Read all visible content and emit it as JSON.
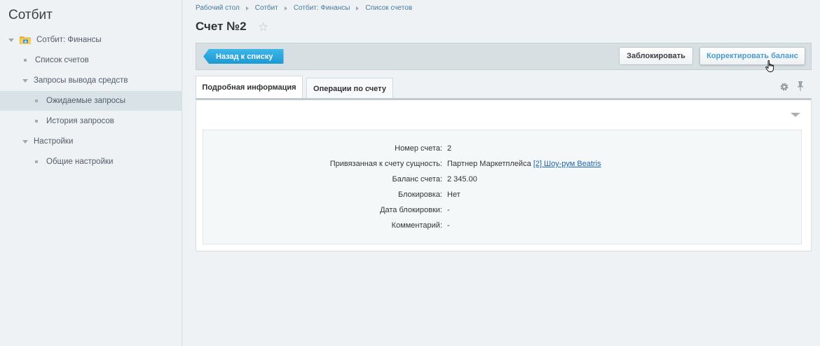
{
  "sidebar": {
    "title": "Сотбит",
    "items": [
      {
        "label": "Сотбит: Финансы"
      },
      {
        "label": "Список счетов"
      },
      {
        "label": "Запросы вывода средств"
      },
      {
        "label": "Ожидаемые запросы"
      },
      {
        "label": "История запросов"
      },
      {
        "label": "Настройки"
      },
      {
        "label": "Общие настройки"
      }
    ]
  },
  "breadcrumb": [
    "Рабочий стол",
    "Сотбит",
    "Сотбит: Финансы",
    "Список счетов"
  ],
  "page": {
    "title": "Счет №2"
  },
  "toolbar": {
    "back_label": "Назад к списку",
    "lock_label": "Заблокировать",
    "correct_label": "Корректировать баланс"
  },
  "tabs": [
    {
      "label": "Подробная информация"
    },
    {
      "label": "Операции по счету"
    }
  ],
  "details": {
    "account_number": {
      "label": "Номер счета:",
      "value": "2"
    },
    "entity": {
      "label": "Привязанная к счету сущность:",
      "value": "Партнер Маркетплейса",
      "link": "[2] Шоу-рум Beatris"
    },
    "balance": {
      "label": "Баланс счета:",
      "value": "2 345.00"
    },
    "blocked": {
      "label": "Блокировка:",
      "value": "Нет"
    },
    "block_date": {
      "label": "Дата блокировки:",
      "value": "-"
    },
    "comment": {
      "label": "Комментарий:",
      "value": "-"
    }
  },
  "colors": {
    "accent": "#1c9ad3",
    "link": "#2066b0",
    "active_nav": "#d9e2e7"
  }
}
